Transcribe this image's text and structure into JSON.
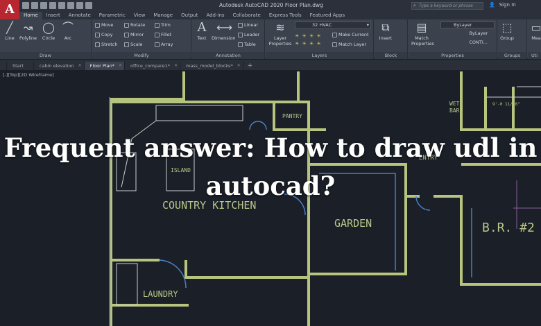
{
  "app": {
    "logo": "A",
    "title": "Autodesk AutoCAD 2020   Floor Plan.dwg",
    "search_placeholder": "Type a keyword or phrase",
    "sign_in": "Sign In"
  },
  "ribbon_tabs": [
    "Home",
    "Insert",
    "Annotate",
    "Parametric",
    "View",
    "Manage",
    "Output",
    "Add-ins",
    "Collaborate",
    "Express Tools",
    "Featured Apps"
  ],
  "ribbon": {
    "draw": {
      "label": "Draw",
      "line": "Line",
      "polyline": "Polyline",
      "circle": "Circle",
      "arc": "Arc"
    },
    "modify": {
      "label": "Modify",
      "move": "Move",
      "rotate": "Rotate",
      "trim": "Trim",
      "copy": "Copy",
      "mirror": "Mirror",
      "fillet": "Fillet",
      "stretch": "Stretch",
      "scale": "Scale",
      "array": "Array"
    },
    "annotation": {
      "label": "Annotation",
      "text": "Text",
      "dimension": "Dimension",
      "linear": "Linear",
      "leader": "Leader",
      "table": "Table"
    },
    "layers": {
      "label": "Layers",
      "layer_properties": "Layer Properties",
      "current_layer": "32 HVAC",
      "make_current": "Make Current",
      "match_layer": "Match Layer"
    },
    "block": {
      "label": "Block",
      "insert": "Insert"
    },
    "properties": {
      "label": "Properties",
      "match_properties": "Match Properties",
      "bylayer1": "ByLayer",
      "bylayer2": "ByLayer",
      "continuous": "CONTI..."
    },
    "groups": {
      "label": "Groups",
      "group": "Group"
    },
    "utilities": {
      "label": "Uti",
      "measure": "Mea"
    }
  },
  "doc_tabs": [
    "Start",
    "cabin elevation",
    "Floor Plan*",
    "office_compare1*",
    "mass_model_blocks*"
  ],
  "viewport_label": "[-][Top][2D Wireframe]",
  "rooms": {
    "pantry": "PANTRY",
    "wet_bar": "WET",
    "wet_bar2": "BAR",
    "dimension": "9'-0 11/16\"",
    "entry": "ENTRY",
    "island": "ISLAND",
    "country_kitchen": "COUNTRY KITCHEN",
    "garden": "GARDEN",
    "br2": "B.R. #2",
    "laundry": "LAUNDRY"
  },
  "overlay_title": "Frequent answer: How to draw udl in autocad?"
}
